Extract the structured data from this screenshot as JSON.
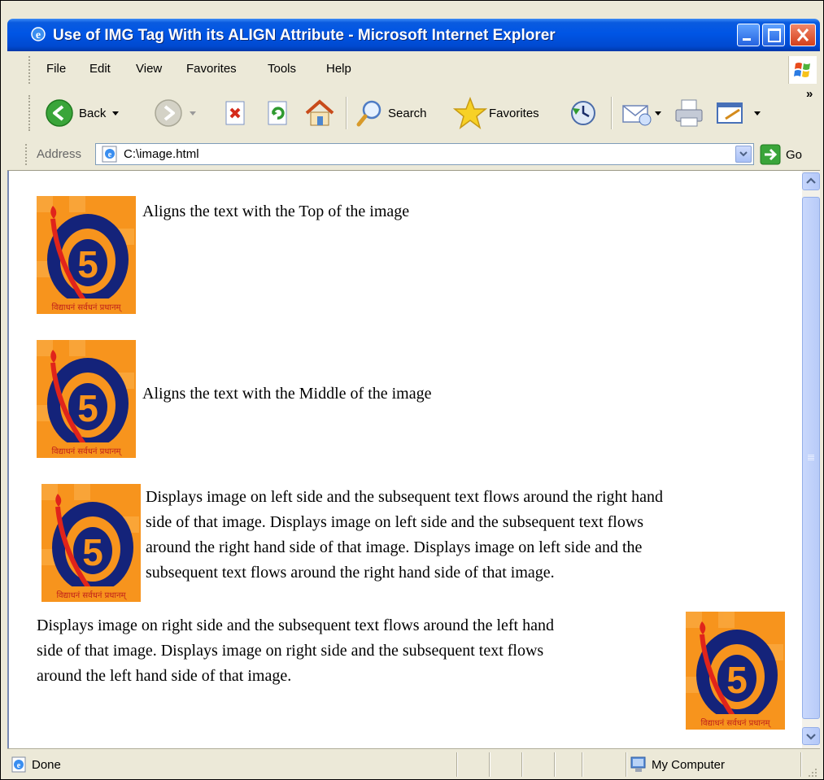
{
  "window": {
    "title": "Use of IMG Tag With its ALIGN Attribute - Microsoft Internet Explorer"
  },
  "menu": [
    "File",
    "Edit",
    "View",
    "Favorites",
    "Tools",
    "Help"
  ],
  "toolbar": {
    "back_label": "Back",
    "search_label": "Search",
    "favorites_label": "Favorites",
    "overflow_label": "»"
  },
  "address": {
    "label": "Address",
    "value": "C:\\image.html",
    "go_label": "Go"
  },
  "content": {
    "logo_caption": "विद्याधनं सर्वधनं प्रधानम्",
    "top_text": "Aligns the text with the Top of the image",
    "middle_text": "Aligns the text with the Middle of the image",
    "left_lines": [
      "Displays image on left side and the subsequent text flows around the right hand",
      "side of that image. Displays image on left side and the subsequent text flows",
      "around the right hand side of that image. Displays image on left side and the",
      "subsequent text flows around the right hand side of that image."
    ],
    "right_lines": [
      "Displays image on right side and the subsequent text flows around the left hand",
      "side of that image. Displays image on right side and the subsequent text flows",
      "around the left hand side of that image."
    ]
  },
  "status": {
    "text": "Done",
    "zone": "My Computer"
  },
  "colors": {
    "titlebar": "#0055E5",
    "chrome": "#ECE9D8",
    "logo_orange": "#F7941D",
    "logo_navy": "#14237A",
    "logo_red": "#E0241B"
  }
}
